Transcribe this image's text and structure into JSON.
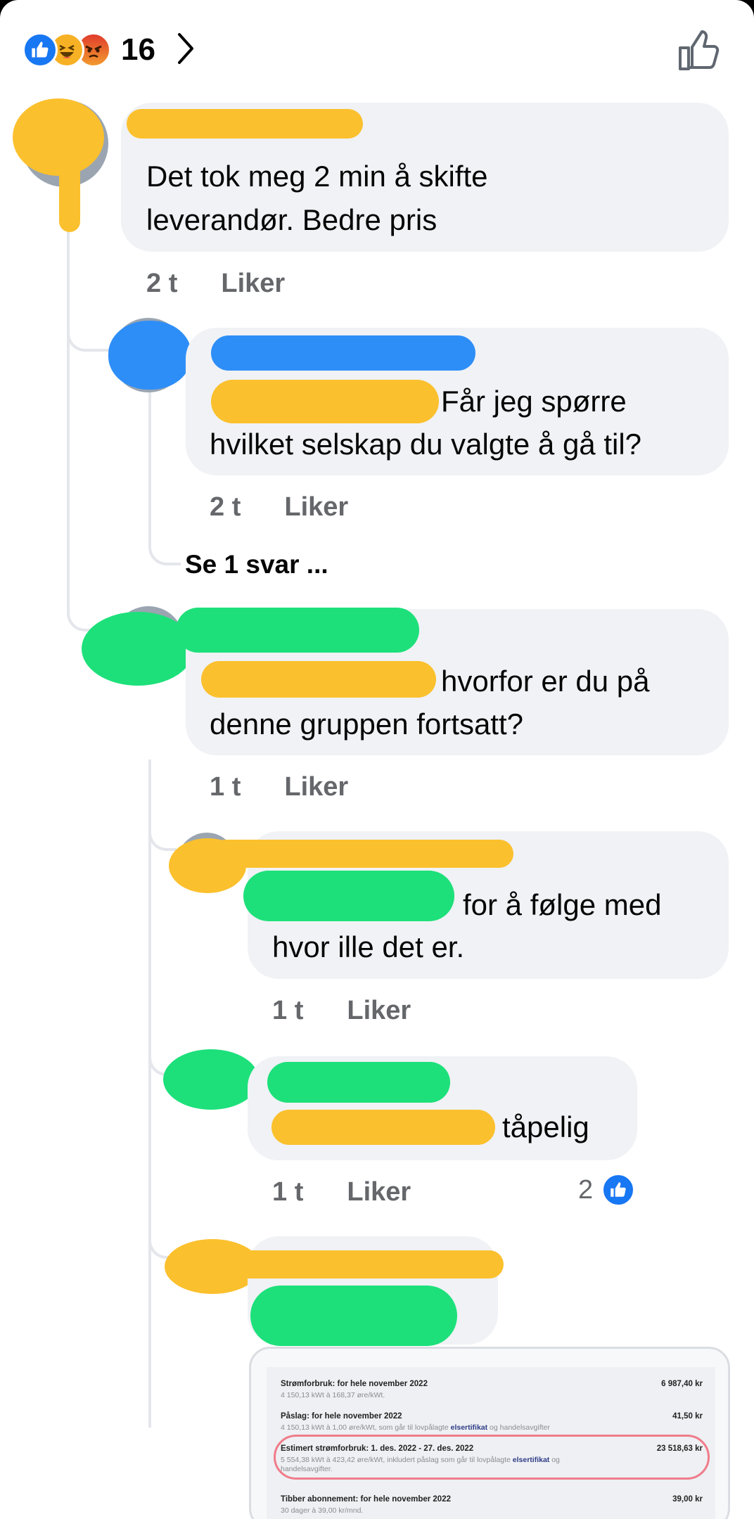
{
  "header": {
    "reaction_count": "16",
    "icons": [
      "like-reaction-icon",
      "haha-reaction-icon",
      "angry-reaction-icon",
      "chevron-right-icon",
      "thumbs-up-outline-icon"
    ]
  },
  "comments": [
    {
      "text_lines": [
        "Det tok meg 2 min å skifte",
        "leverandør. Bedre pris"
      ],
      "time": "2 t",
      "like_label": "Liker"
    },
    {
      "text_lines": [
        "Får jeg spørre",
        "hvilket selskap du valgte å gå til?"
      ],
      "time": "2 t",
      "like_label": "Liker",
      "see_replies": "Se 1 svar ..."
    },
    {
      "text_lines": [
        "hvorfor er du på",
        "denne gruppen fortsatt?"
      ],
      "time": "1 t",
      "like_label": "Liker"
    },
    {
      "text_lines": [
        "for å følge med",
        "hvor ille det er."
      ],
      "time": "1 t",
      "like_label": "Liker"
    },
    {
      "text_lines": [
        "tåpelig"
      ],
      "time": "1 t",
      "like_label": "Liker",
      "reaction_count": "2"
    },
    {
      "text_lines": []
    }
  ],
  "attachment": {
    "rows": [
      {
        "label": "Strømforbruk: for hele november 2022",
        "amount": "6 987,40 kr",
        "detail": "4 150,13 kWt à 168,37 øre/kWt."
      },
      {
        "label": "Påslag: for hele november 2022",
        "amount": "41,50 kr",
        "detail_pre": "4 150,13 kWt à 1,00 øre/kWt, som går til lovpålagte ",
        "detail_link": "elsertifikat",
        "detail_post": " og handelsavgifter"
      },
      {
        "label": "Estimert strømforbruk: 1. des. 2022 - 27. des. 2022",
        "amount": "23 518,63 kr",
        "detail_pre": "5 554,38 kWt à 423,42 øre/kWt, inkludert påslag som går til lovpålagte ",
        "detail_link": "elsertifikat",
        "detail_post": " og handelsavgifter."
      },
      {
        "label": "Tibber abonnement: for hele november 2022",
        "amount": "39,00 kr",
        "detail": "30 dager à 39,00 kr/mnd."
      }
    ]
  },
  "colors": {
    "bubble": "#f0f2f5",
    "meta": "#65676b",
    "facebook_blue": "#1877f2",
    "highlight": "#f07c8a"
  }
}
